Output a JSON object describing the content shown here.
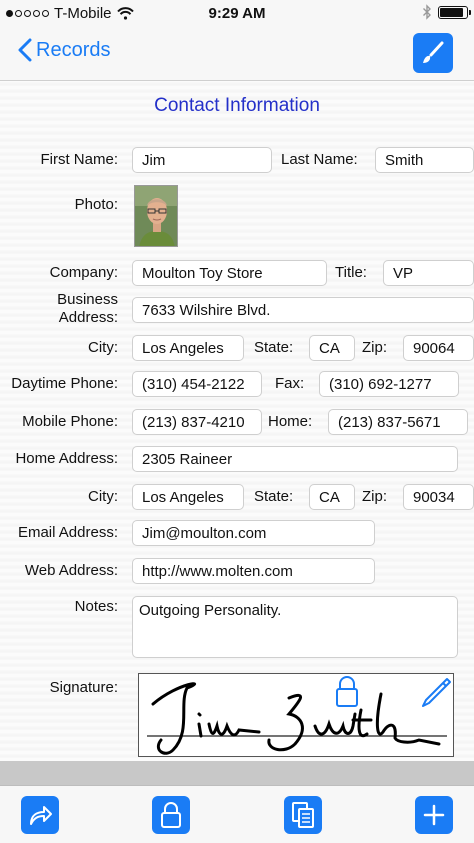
{
  "status_bar": {
    "carrier": "T-Mobile",
    "time": "9:29 AM",
    "signal_bars": 1,
    "battery_level": 0.9
  },
  "nav": {
    "back_label": "Records",
    "edit_icon": "brush-icon"
  },
  "form": {
    "title": "Contact Information",
    "labels": {
      "first_name": "First Name:",
      "last_name": "Last Name:",
      "photo": "Photo:",
      "company": "Company:",
      "title": "Title:",
      "business_address": "Business Address:",
      "city": "City:",
      "state": "State:",
      "zip": "Zip:",
      "daytime_phone": "Daytime Phone:",
      "fax": "Fax:",
      "mobile_phone": "Mobile Phone:",
      "home": "Home:",
      "home_address": "Home Address:",
      "email": "Email Address:",
      "web": "Web Address:",
      "notes": "Notes:",
      "signature": "Signature:"
    },
    "values": {
      "first_name": "Jim",
      "last_name": "Smith",
      "company": "Moulton Toy Store",
      "title": "VP",
      "business_address": "7633 Wilshire Blvd.",
      "business_city": "Los Angeles",
      "business_state": "CA",
      "business_zip": "90064",
      "daytime_phone": "(310) 454-2122",
      "fax": "(310) 692-1277",
      "mobile_phone": "(213) 837-4210",
      "home_phone": "(213) 837-5671",
      "home_address": "2305 Raineer",
      "home_city": "Los Angeles",
      "home_state": "CA",
      "home_zip": "90034",
      "email": "Jim@moulton.com",
      "web": "http://www.molten.com",
      "notes": "Outgoing Personality."
    }
  },
  "toolbar": {
    "buttons": [
      "share-icon",
      "lock-icon",
      "duplicate-icon",
      "add-icon"
    ]
  },
  "colors": {
    "accent": "#1a7cf5",
    "title": "#2430c9"
  }
}
